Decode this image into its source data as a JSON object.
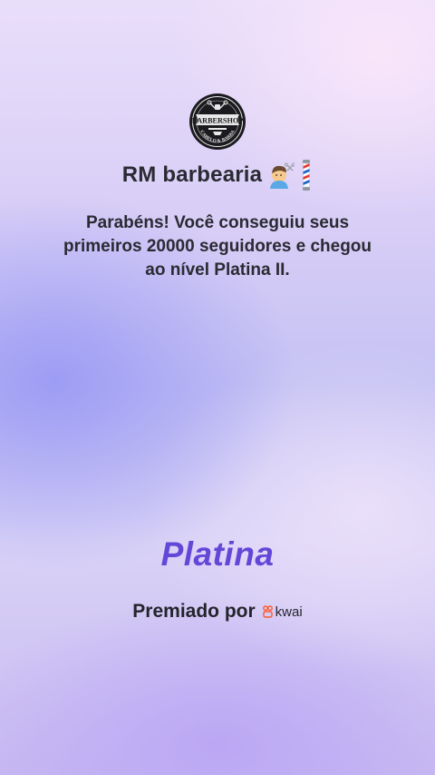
{
  "profile": {
    "logo_icon": "barbershop-logo",
    "logo_text": "BARBERSHOP CABELO & BARBA",
    "name": "RM barbearia",
    "name_emojis": [
      "barber-haircut-emoji",
      "barber-pole-emoji"
    ]
  },
  "message": {
    "line1": "Parabéns! Você conseguiu seus",
    "line2": "primeiros 20000 seguidores e chegou",
    "line3": "ao nível Platina II."
  },
  "level": {
    "name": "Platina",
    "color": "#6348d8"
  },
  "award": {
    "label": "Premiado por",
    "brand_icon": "kwai-logo-icon",
    "brand_name": "kwai",
    "brand_color": "#ff5a2b"
  },
  "colors": {
    "text": "#2a2a33",
    "background_top": "#e9defa",
    "background_mid": "#c4c1f3"
  }
}
